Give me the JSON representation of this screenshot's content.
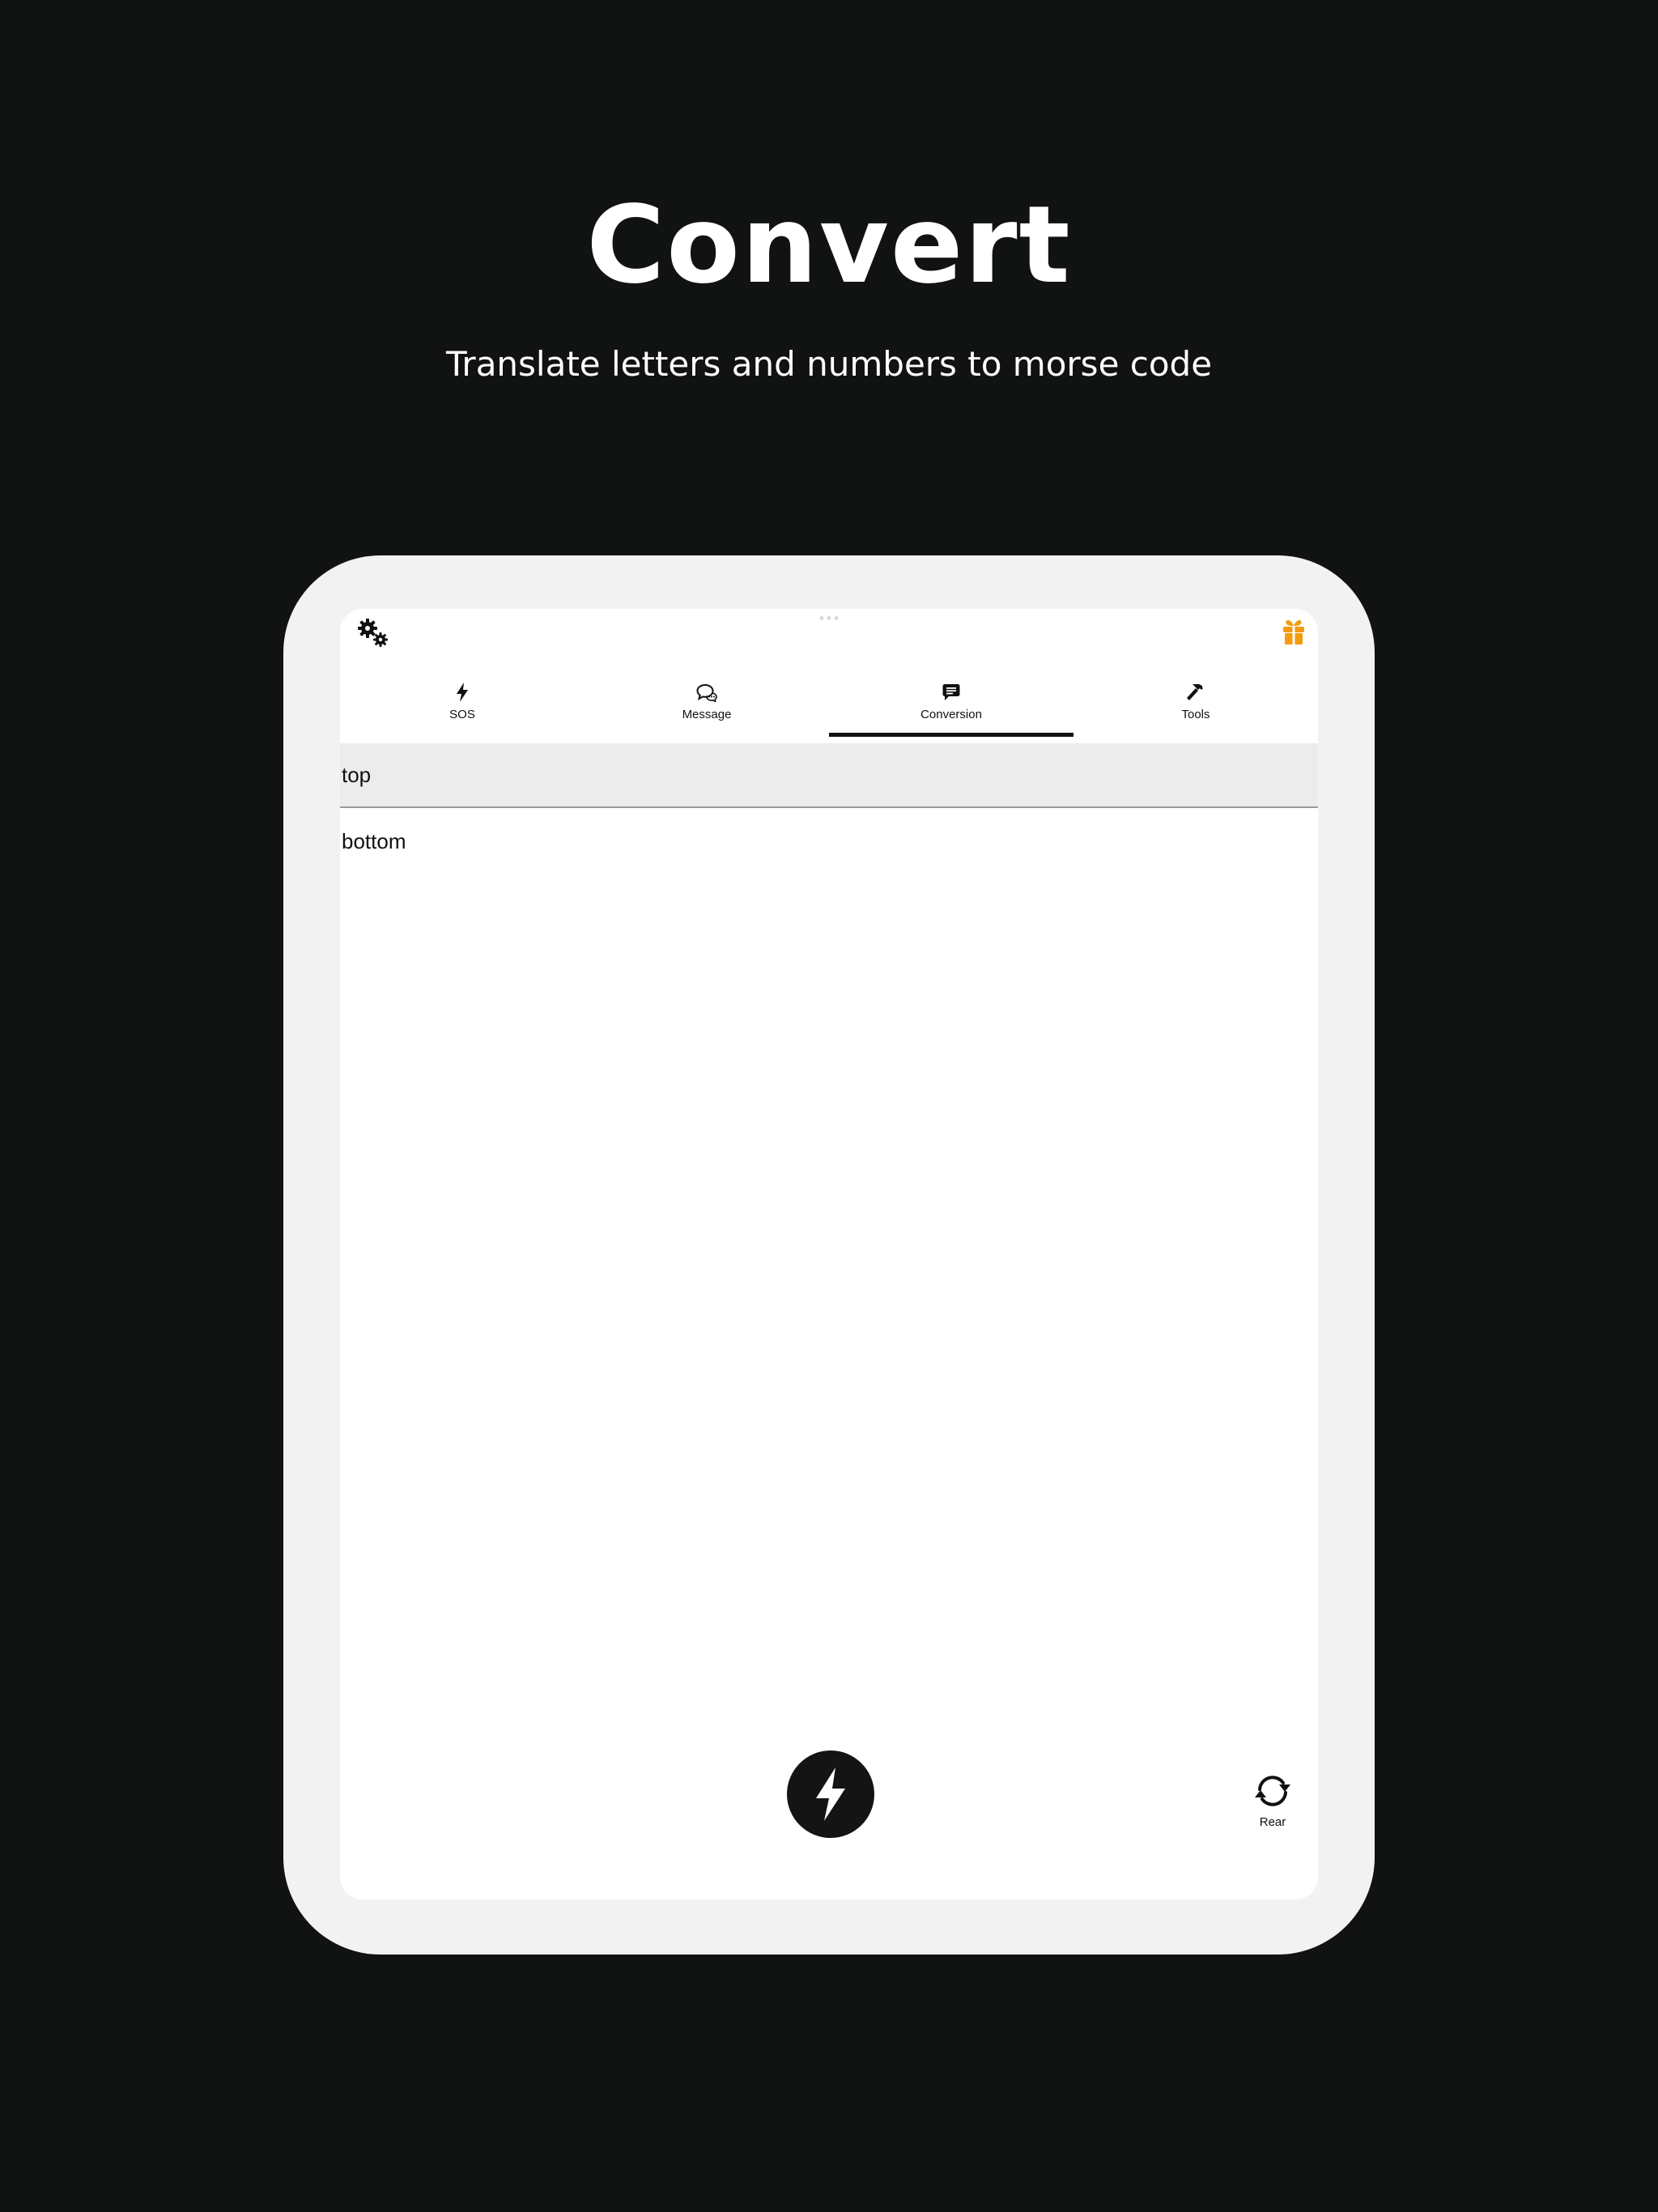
{
  "promo": {
    "title": "Convert",
    "subtitle": "Translate letters and numbers to morse code"
  },
  "header": {
    "settings_icon": "gears-icon",
    "gift_icon": "gift-icon",
    "gift_color": "#f39c12"
  },
  "tabs": [
    {
      "label": "SOS",
      "icon": "lightning-icon",
      "active": false
    },
    {
      "label": "Message",
      "icon": "chat-bubbles-icon",
      "active": false
    },
    {
      "label": "Conversion",
      "icon": "message-icon",
      "active": true
    },
    {
      "label": "Tools",
      "icon": "hammer-icon",
      "active": false
    }
  ],
  "conversion": {
    "top_placeholder": "top",
    "bottom_placeholder": "bottom"
  },
  "controls": {
    "flash_icon": "lightning-icon",
    "rear_icon": "camera-switch-icon",
    "rear_label": "Rear"
  },
  "colors": {
    "background": "#111212",
    "device_frame": "#f2f2f2",
    "accent": "#111111",
    "input_background": "#ececec"
  }
}
